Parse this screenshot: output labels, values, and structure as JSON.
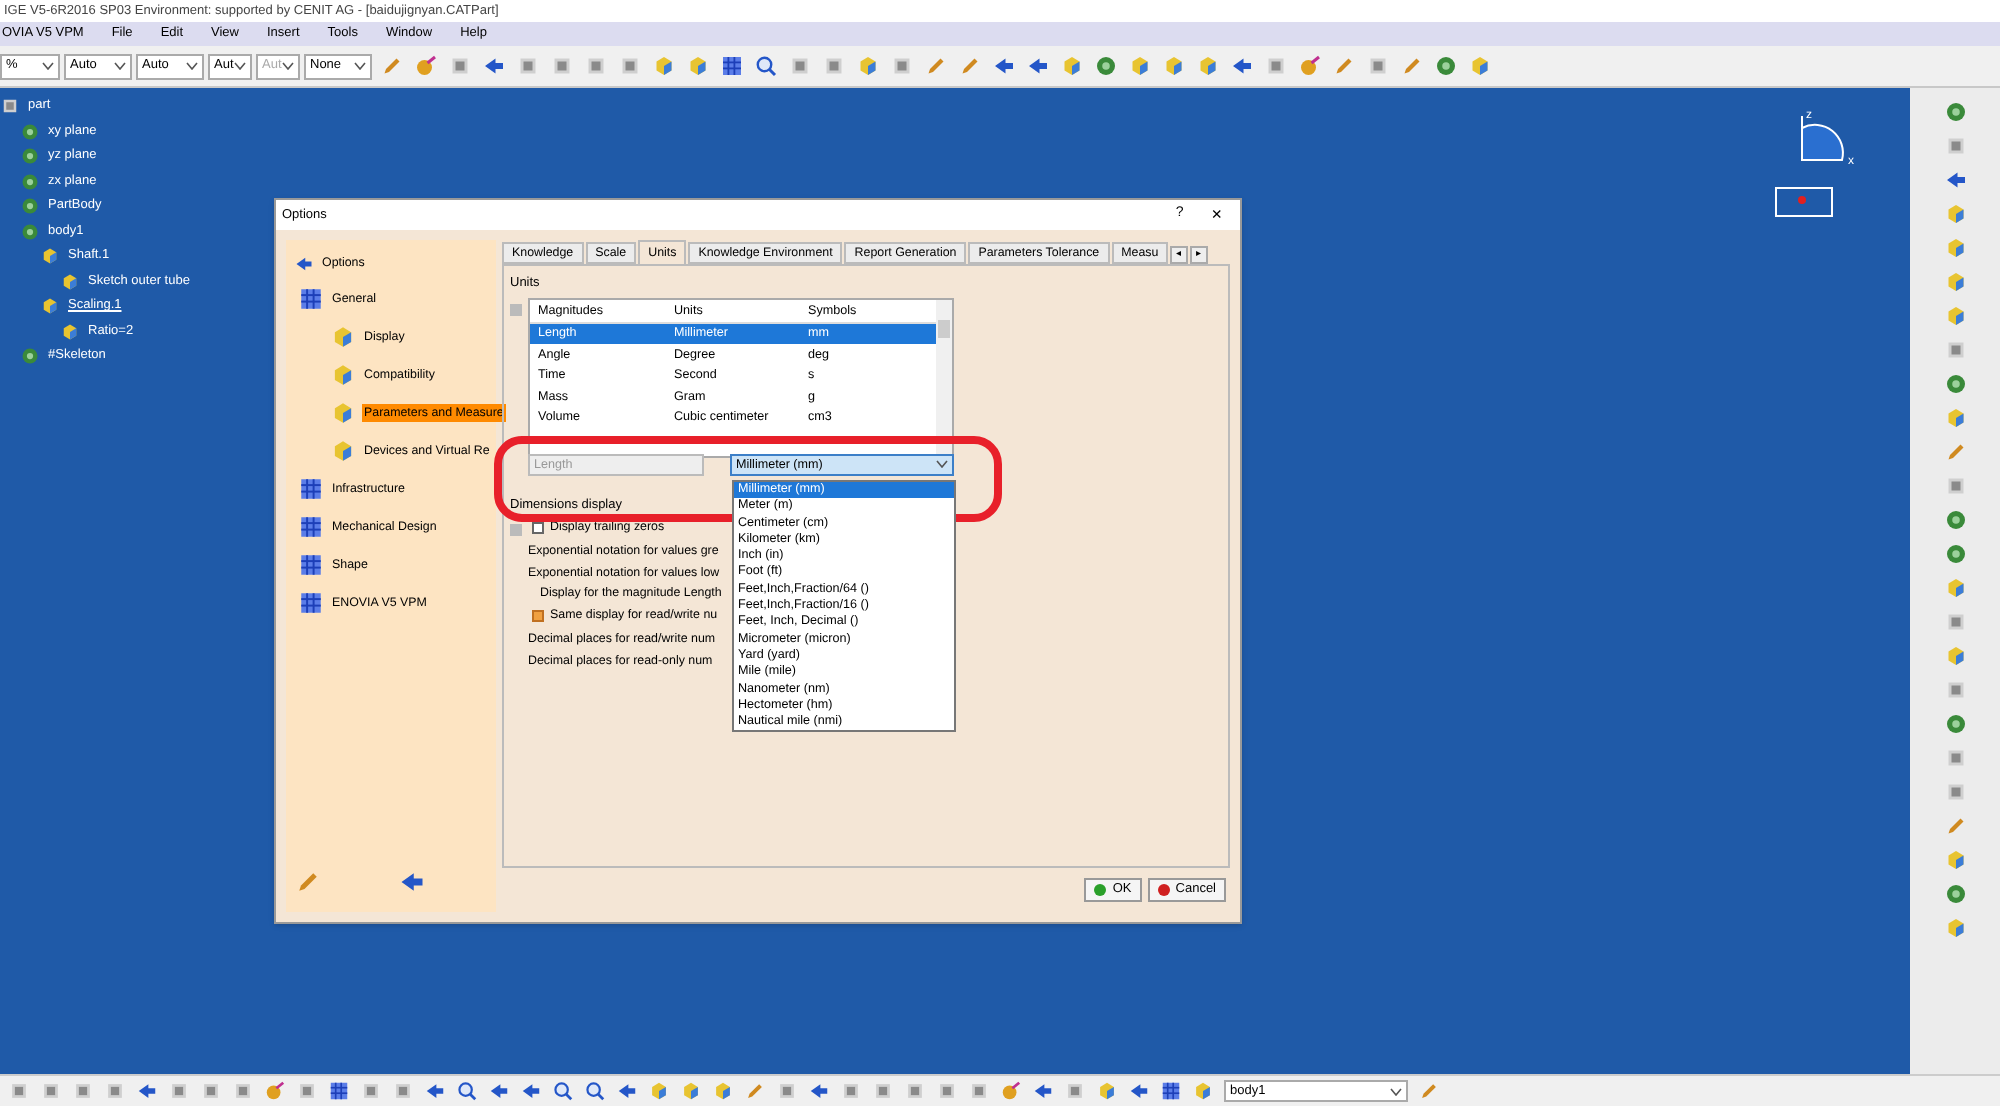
{
  "window": {
    "title": "IGE V5-6R2016 SP03 Environment: supported by CENIT AG - [baidujignyan.CATPart]"
  },
  "menu": [
    {
      "label": "OVIA V5 VPM"
    },
    {
      "label": "File"
    },
    {
      "label": "Edit"
    },
    {
      "label": "View"
    },
    {
      "label": "Insert"
    },
    {
      "label": "Tools"
    },
    {
      "label": "Window"
    },
    {
      "label": "Help"
    }
  ],
  "toolbar_combos": [
    {
      "value": "%",
      "disabled": false
    },
    {
      "value": "Auto",
      "disabled": false
    },
    {
      "value": "Auto",
      "disabled": false
    },
    {
      "value": "Aut",
      "disabled": false
    },
    {
      "value": "Aut",
      "disabled": true
    },
    {
      "value": "None",
      "disabled": false
    }
  ],
  "spec_tree": [
    {
      "label": "part",
      "underlined": false,
      "children": [
        {
          "label": "xy plane",
          "underlined": false
        },
        {
          "label": "yz plane",
          "underlined": false
        },
        {
          "label": "zx plane",
          "underlined": false
        },
        {
          "label": "PartBody",
          "underlined": false
        },
        {
          "label": "body1",
          "underlined": false,
          "children": [
            {
              "label": "Shaft.1",
              "underlined": false,
              "children": [
                {
                  "label": "Sketch outer tube",
                  "underlined": false
                }
              ]
            },
            {
              "label": "Scaling.1",
              "underlined": true,
              "children": [
                {
                  "label": "Ratio=2",
                  "underlined": false
                }
              ]
            }
          ]
        },
        {
          "label": "#Skeleton",
          "underlined": false
        }
      ]
    }
  ],
  "dialog": {
    "title": "Options",
    "help": "?",
    "close": "×",
    "tree": [
      {
        "label": "Options",
        "selected": false,
        "children": [
          {
            "label": "General",
            "selected": false,
            "children": [
              {
                "label": "Display",
                "selected": false
              },
              {
                "label": "Compatibility",
                "selected": false
              },
              {
                "label": "Parameters and Measure",
                "selected": true
              },
              {
                "label": "Devices and Virtual Re",
                "selected": false
              }
            ]
          },
          {
            "label": "Infrastructure",
            "selected": false
          },
          {
            "label": "Mechanical Design",
            "selected": false
          },
          {
            "label": "Shape",
            "selected": false
          },
          {
            "label": "ENOVIA V5 VPM",
            "selected": false
          }
        ]
      }
    ],
    "tabs": [
      {
        "label": "Knowledge",
        "selected": false
      },
      {
        "label": "Scale",
        "selected": false
      },
      {
        "label": "Units",
        "selected": true
      },
      {
        "label": "Knowledge Environment",
        "selected": false
      },
      {
        "label": "Report Generation",
        "selected": false
      },
      {
        "label": "Parameters Tolerance",
        "selected": false
      },
      {
        "label": "Measu",
        "selected": false
      }
    ],
    "tab_scroll": [
      "◂",
      "▸"
    ],
    "units_group": {
      "title": "Units",
      "columns": [
        "Magnitudes",
        "Units",
        "Symbols"
      ],
      "rows": [
        {
          "cells": [
            "Length",
            "Millimeter",
            "mm"
          ],
          "selected": true
        },
        {
          "cells": [
            "Angle",
            "Degree",
            "deg"
          ],
          "selected": false
        },
        {
          "cells": [
            "Time",
            "Second",
            "s"
          ],
          "selected": false
        },
        {
          "cells": [
            "Mass",
            "Gram",
            "g"
          ],
          "selected": false
        },
        {
          "cells": [
            "Volume",
            "Cubic centimeter",
            "cm3"
          ],
          "selected": false
        }
      ],
      "magnitude_field": {
        "value": "Length",
        "disabled": true
      },
      "unit_combo": {
        "value": "Millimeter (mm)",
        "expanded": true,
        "options": [
          {
            "label": "Millimeter (mm)",
            "selected": true
          },
          {
            "label": "Meter (m)",
            "selected": false
          },
          {
            "label": "Centimeter (cm)",
            "selected": false
          },
          {
            "label": "Kilometer (km)",
            "selected": false
          },
          {
            "label": "Inch (in)",
            "selected": false
          },
          {
            "label": "Foot (ft)",
            "selected": false
          },
          {
            "label": "Feet,Inch,Fraction/64 ()",
            "selected": false
          },
          {
            "label": "Feet,Inch,Fraction/16 ()",
            "selected": false
          },
          {
            "label": "Feet, Inch, Decimal ()",
            "selected": false
          },
          {
            "label": "Micrometer (micron)",
            "selected": false
          },
          {
            "label": "Yard (yard)",
            "selected": false
          },
          {
            "label": "Mile (mile)",
            "selected": false
          },
          {
            "label": "Nanometer (nm)",
            "selected": false
          },
          {
            "label": "Hectometer (hm)",
            "selected": false
          },
          {
            "label": "Nautical mile (nmi)",
            "selected": false
          }
        ]
      }
    },
    "dimensions_group": {
      "title": "Dimensions display",
      "lines": [
        {
          "kind": "checkbox",
          "label": "Display trailing zeros",
          "checked": false
        },
        {
          "kind": "text",
          "label": "Exponential notation for values gre"
        },
        {
          "kind": "text",
          "label": "Exponential notation for values low"
        },
        {
          "kind": "subtitle",
          "label": "Display for the magnitude Length"
        },
        {
          "kind": "checkbox",
          "label": "Same display for read/write nu",
          "checked": true
        },
        {
          "kind": "text",
          "label": "Decimal places for read/write num"
        },
        {
          "kind": "text",
          "label": "Decimal places for read-only num"
        }
      ]
    },
    "buttons": [
      {
        "label": "OK",
        "kind": "ok"
      },
      {
        "label": "Cancel",
        "kind": "cancel"
      }
    ]
  },
  "bottom_toolbar": {
    "body_combo": "body1"
  },
  "compass": {
    "axis_x": "x",
    "axis_z": "z"
  }
}
